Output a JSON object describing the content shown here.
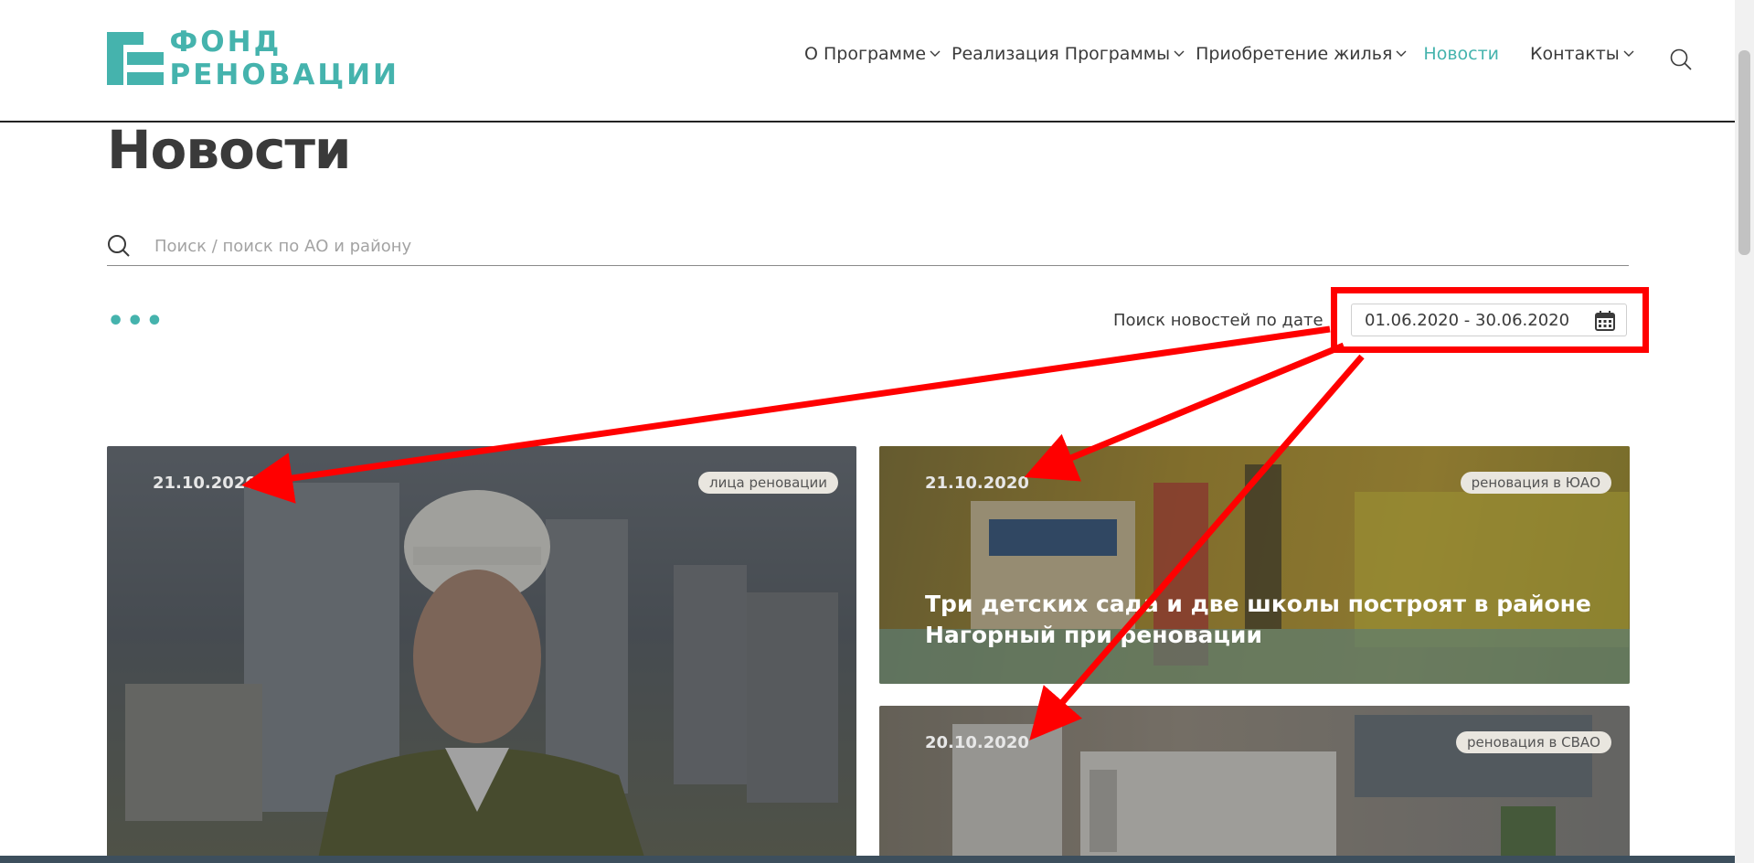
{
  "logo": {
    "line1": "ФОНД",
    "line2": "РЕНОВАЦИИ"
  },
  "nav": {
    "items": [
      {
        "label": "О Программе",
        "dropdown": true
      },
      {
        "label": "Реализация Программы",
        "dropdown": true
      },
      {
        "label": "Приобретение жилья",
        "dropdown": true
      },
      {
        "label": "Новости",
        "dropdown": false,
        "active": true
      },
      {
        "label": "Контакты",
        "dropdown": true
      }
    ]
  },
  "page": {
    "title": "Новости"
  },
  "search": {
    "placeholder": "Поиск / поиск по АО и району"
  },
  "filter": {
    "dots": "•••",
    "date_label": "Поиск новостей по дате",
    "date_range": "01.06.2020 - 30.06.2020"
  },
  "cards": [
    {
      "date": "21.10.2020",
      "tag": "лица реновации",
      "title": ""
    },
    {
      "date": "21.10.2020",
      "tag": "реновация в ЮАО",
      "title": "Три детских сада и две школы построят в районе Нагорный при реновации"
    },
    {
      "date": "20.10.2020",
      "tag": "реновация в СВАО",
      "title": ""
    }
  ],
  "colors": {
    "accent": "#45b3ad",
    "annotation": "#ff0000",
    "text": "#3a3a3a"
  }
}
